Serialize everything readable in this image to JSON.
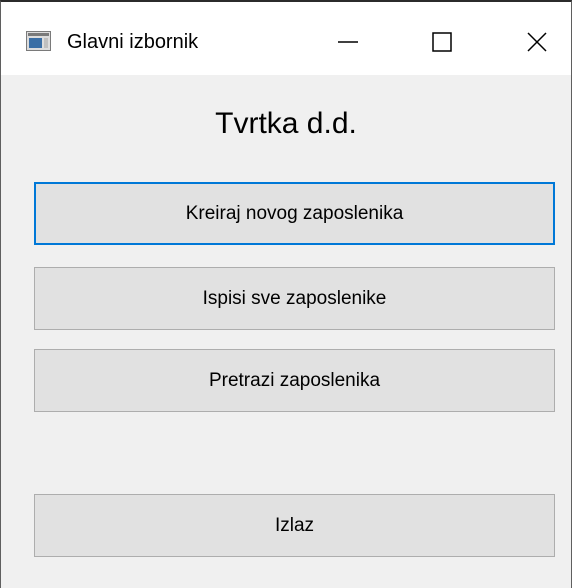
{
  "window": {
    "title": "Glavni izbornik",
    "icon": "app-window-icon",
    "controls": {
      "minimize_icon": "minimize-icon",
      "maximize_icon": "maximize-icon",
      "close_icon": "close-icon"
    }
  },
  "main": {
    "heading": "Tvrtka d.d.",
    "buttons": [
      {
        "label": "Kreiraj novog zaposlenika",
        "focused": true
      },
      {
        "label": "Ispisi sve zaposlenike",
        "focused": false
      },
      {
        "label": "Pretrazi zaposlenika",
        "focused": false
      },
      {
        "label": "Izlaz",
        "focused": false
      }
    ]
  },
  "colors": {
    "titlebar_bg": "#ffffff",
    "client_bg": "#f0f0f0",
    "button_bg": "#e1e1e1",
    "button_border": "#adadad",
    "focus_border": "#0078d7"
  }
}
